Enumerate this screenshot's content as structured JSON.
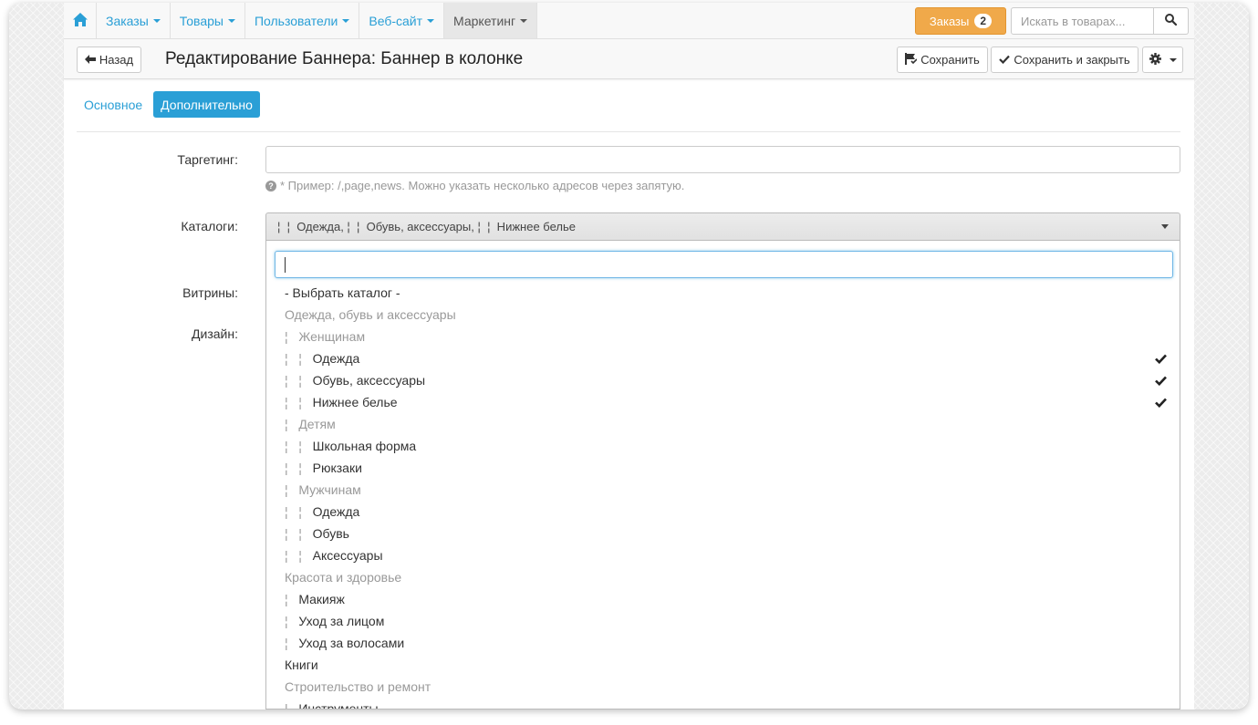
{
  "nav": {
    "items": [
      {
        "label": "Заказы"
      },
      {
        "label": "Товары"
      },
      {
        "label": "Пользователи"
      },
      {
        "label": "Веб-сайт"
      },
      {
        "label": "Маркетинг"
      }
    ],
    "orders_label": "Заказы",
    "orders_count": "2",
    "search_placeholder": "Искать в товарах..."
  },
  "titlebar": {
    "back_label": "Назад",
    "title": "Редактирование Баннера: Баннер в колонке",
    "save_label": "Сохранить",
    "save_close_label": "Сохранить и закрыть"
  },
  "tabs": [
    {
      "label": "Основное"
    },
    {
      "label": "Дополнительно"
    }
  ],
  "form": {
    "targeting_label": "Таргетинг:",
    "targeting_value": "",
    "targeting_hint": "* Пример: /,page,news. Можно указать несколько адресов через запятую.",
    "catalogs_label": "Каталоги:",
    "catalogs_selected": "¦  ¦  Одежда, ¦  ¦  Обувь, аксессуары, ¦  ¦  Нижнее белье",
    "showcases_label": "Витрины:",
    "design_label": "Дизайн:"
  },
  "dropdown": {
    "search_value": "",
    "options": [
      {
        "prefix": "",
        "text": "- Выбрать каталог -",
        "group": false,
        "checked": false
      },
      {
        "prefix": "",
        "text": "Одежда, обувь и аксессуары",
        "group": true,
        "checked": false
      },
      {
        "prefix": "¦   ",
        "text": "Женщинам",
        "group": true,
        "checked": false
      },
      {
        "prefix": "¦   ¦   ",
        "text": "Одежда",
        "group": false,
        "checked": true
      },
      {
        "prefix": "¦   ¦   ",
        "text": "Обувь, аксессуары",
        "group": false,
        "checked": true
      },
      {
        "prefix": "¦   ¦   ",
        "text": "Нижнее белье",
        "group": false,
        "checked": true
      },
      {
        "prefix": "¦   ",
        "text": "Детям",
        "group": true,
        "checked": false
      },
      {
        "prefix": "¦   ¦   ",
        "text": "Школьная форма",
        "group": false,
        "checked": false
      },
      {
        "prefix": "¦   ¦   ",
        "text": "Рюкзаки",
        "group": false,
        "checked": false
      },
      {
        "prefix": "¦   ",
        "text": "Мужчинам",
        "group": true,
        "checked": false
      },
      {
        "prefix": "¦   ¦   ",
        "text": "Одежда",
        "group": false,
        "checked": false
      },
      {
        "prefix": "¦   ¦   ",
        "text": "Обувь",
        "group": false,
        "checked": false
      },
      {
        "prefix": "¦   ¦   ",
        "text": "Аксессуары",
        "group": false,
        "checked": false
      },
      {
        "prefix": "",
        "text": "Красота и здоровье",
        "group": true,
        "checked": false
      },
      {
        "prefix": "¦   ",
        "text": "Макияж",
        "group": false,
        "checked": false
      },
      {
        "prefix": "¦   ",
        "text": "Уход за лицом",
        "group": false,
        "checked": false
      },
      {
        "prefix": "¦   ",
        "text": "Уход за волосами",
        "group": false,
        "checked": false
      },
      {
        "prefix": "",
        "text": "Книги",
        "group": false,
        "checked": false
      },
      {
        "prefix": "",
        "text": "Строительство и ремонт",
        "group": true,
        "checked": false
      },
      {
        "prefix": "¦   ",
        "text": "Инструменты",
        "group": false,
        "checked": false
      }
    ]
  },
  "icons": {
    "home": "home-icon",
    "search": "search-icon",
    "back": "arrow-left-icon",
    "save": "save-flag-icon",
    "check": "check-icon",
    "gear": "gear-icon",
    "hint": "question-circle-icon"
  },
  "colors": {
    "link": "#2a9fd6",
    "orders_button": "#f0a94a",
    "active_tab": "#2a9fd6",
    "group_text": "#999999"
  }
}
